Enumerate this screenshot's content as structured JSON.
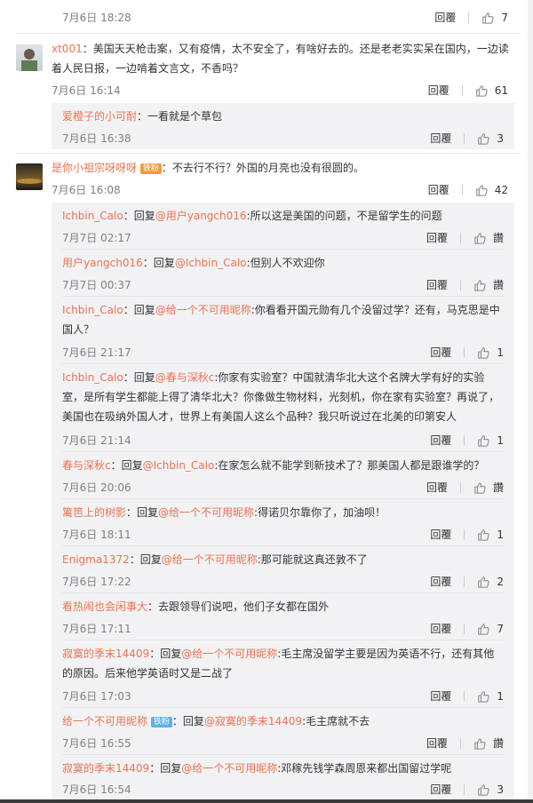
{
  "top": {
    "time": "7月6日 18:28",
    "reply": "回覆",
    "likes": "7"
  },
  "c1": {
    "user": "xt001",
    "text": "：美国天天枪击案，又有疫情，太不安全了，有啥好去的。还是老老实实呆在国内，一边读着人民日报，一边啃着文言文，不香吗？",
    "time": "7月6日 16:14",
    "reply": "回覆",
    "likes": "61",
    "sub": [
      {
        "user": "爱橙子的小可耐",
        "text": "：一看就是个草包",
        "time": "7月6日 16:38",
        "reply": "回覆",
        "likes": "3"
      }
    ]
  },
  "c2": {
    "user": "是你小祖宗呀呀呀",
    "badge": "铁粉",
    "text": "：不去行不行？外国的月亮也没有很圆的。",
    "time": "7月6日 16:08",
    "reply": "回覆",
    "likes": "42",
    "sub": [
      {
        "user": "Ichbin_Calo",
        "pre": "：回复",
        "at": "@用户yangch016",
        "text": ":所以这是美国的问题，不是留学生的问题",
        "time": "7月7日 02:17",
        "reply": "回覆",
        "likes": "讚"
      },
      {
        "user": "用户yangch016",
        "pre": "：回复",
        "at": "@Ichbin_Calo",
        "text": ":但别人不欢迎你",
        "time": "7月7日 00:37",
        "reply": "回覆",
        "likes": "讚"
      },
      {
        "user": "Ichbin_Calo",
        "pre": "：回复",
        "at": "@给一个不可用昵称",
        "text": ":你看看开国元勋有几个没留过学？还有，马克思是中国人？",
        "time": "7月6日 21:17",
        "reply": "回覆",
        "likes": "1"
      },
      {
        "user": "Ichbin_Calo",
        "pre": "：回复",
        "at": "@春与深秋c",
        "text": ":你家有实验室？中国就清华北大这个名牌大学有好的实验室，是所有学生都能上得了清华北大？你像做生物材料，光刻机，你在家有实验室？再说了，美国也在吸纳外国人才，世界上有美国人这么个品种？我只听说过在北美的印第安人",
        "time": "7月6日 21:14",
        "reply": "回覆",
        "likes": "1"
      },
      {
        "user": "春与深秋c",
        "pre": "：回复",
        "at": "@Ichbin_Calo",
        "text": ":在家怎么就不能学到新技术了？那美国人都是跟谁学的？",
        "time": "7月6日 20:06",
        "reply": "回覆",
        "likes": "讚"
      },
      {
        "user": "篱笆上的树影",
        "pre": "：回复",
        "at": "@给一个不可用昵称",
        "text": ":得诺贝尔靠你了，加油呗！",
        "time": "7月6日 18:11",
        "reply": "回覆",
        "likes": "1"
      },
      {
        "user": "Enigma1372",
        "pre": "：回复",
        "at": "@给一个不可用昵称",
        "text": ":那可能就这真还敦不了",
        "time": "7月6日 17:22",
        "reply": "回覆",
        "likes": "2"
      },
      {
        "user": "看热闹也会闲事大",
        "pre": "：去跟领导们说吧，他们子女都在国外",
        "at": "",
        "text": "",
        "time": "7月6日 17:11",
        "reply": "回覆",
        "likes": "7"
      },
      {
        "user": "寂寞的季末14409",
        "pre": "：回复",
        "at": "@给一个不可用昵称",
        "text": ":毛主席没留学主要是因为英语不行，还有其他的原因。后来他学英语时又是二战了",
        "time": "7月6日 17:03",
        "reply": "回覆",
        "likes": "1"
      },
      {
        "user": "给一个不可用昵称",
        "badge": "铁粉",
        "pre": "：回复",
        "at": "@寂寞的季末14409",
        "text": ":毛主席就不去",
        "time": "7月6日 16:55",
        "reply": "回覆",
        "likes": "讚"
      },
      {
        "user": "寂寞的季末14409",
        "pre": "：回复",
        "at": "@给一个不可用昵称",
        "text": ":邓稼先钱学森周恩来都出国留过学呢",
        "time": "7月6日 16:54",
        "reply": "回覆",
        "likes": "3"
      }
    ]
  }
}
